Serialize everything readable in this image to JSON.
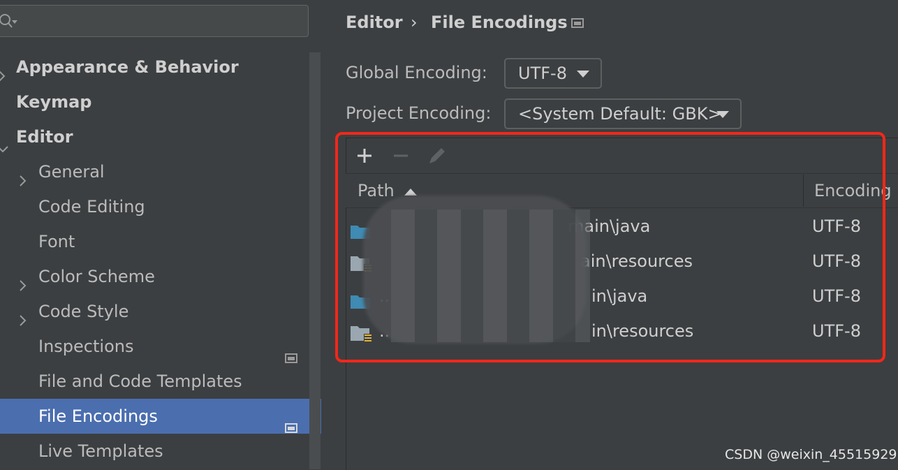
{
  "sidebar": {
    "search_placeholder": "",
    "items": [
      {
        "label": "Appearance & Behavior",
        "bold": true
      },
      {
        "label": "Keymap",
        "bold": true
      },
      {
        "label": "Editor",
        "bold": true
      },
      {
        "label": "General"
      },
      {
        "label": "Code Editing"
      },
      {
        "label": "Font"
      },
      {
        "label": "Color Scheme"
      },
      {
        "label": "Code Style"
      },
      {
        "label": "Inspections"
      },
      {
        "label": "File and Code Templates"
      },
      {
        "label": "File Encodings",
        "selected": true
      },
      {
        "label": "Live Templates"
      }
    ]
  },
  "header": {
    "breadcrumb": [
      "Editor",
      "File Encodings"
    ],
    "separator": "›"
  },
  "settings": {
    "global_encoding_label": "Global Encoding:",
    "global_encoding_value": "UTF-8",
    "project_encoding_label": "Project Encoding:",
    "project_encoding_value": "<System Default: GBK>"
  },
  "table": {
    "toolbar": [
      "add-icon",
      "remove-icon",
      "edit-icon"
    ],
    "columns": [
      "Path",
      "Encoding"
    ],
    "rows": [
      {
        "path": "main\\java",
        "encoding": "UTF-8",
        "icon": "source-folder-icon"
      },
      {
        "path": "ain\\resources",
        "encoding": "UTF-8",
        "icon": "resources-folder-icon"
      },
      {
        "path": "..",
        "path_tail": "in\\java",
        "encoding": "UTF-8",
        "icon": "source-folder-icon"
      },
      {
        "path": "..",
        "path_tail": "in\\resources",
        "encoding": "UTF-8",
        "icon": "resources-folder-icon"
      }
    ]
  },
  "watermark": "CSDN @weixin_45515929",
  "colors": {
    "background": "#3c3f41",
    "selection": "#4b6eaf",
    "highlight_box": "#f2271a",
    "folder_blue": "#3f8bb3"
  }
}
